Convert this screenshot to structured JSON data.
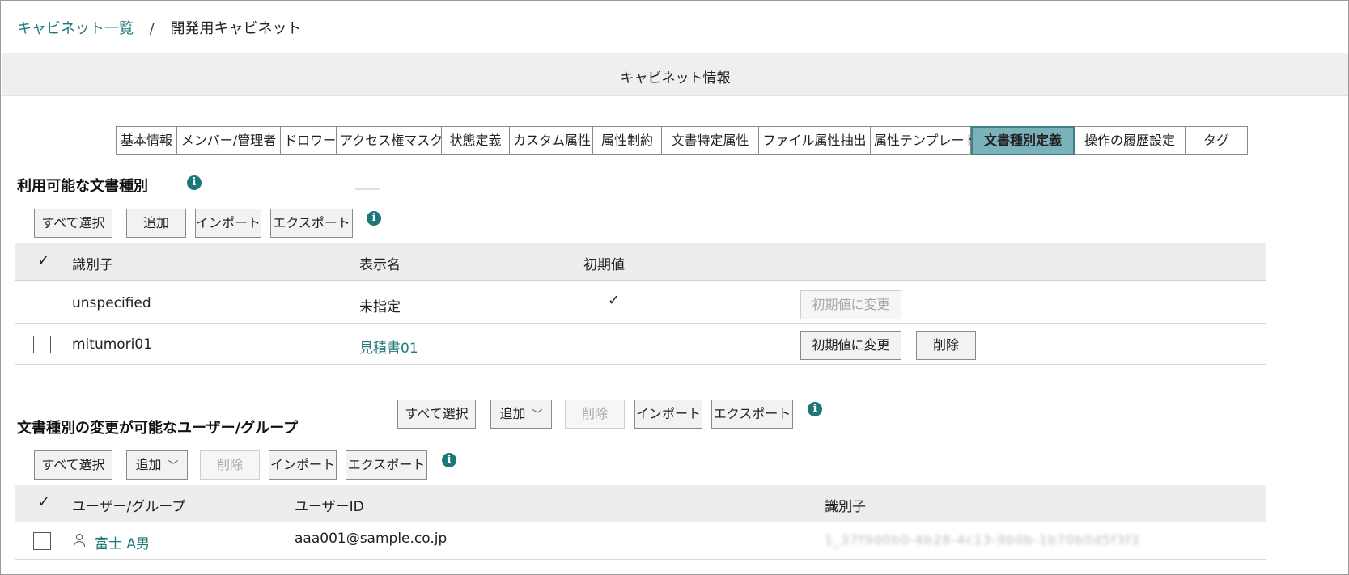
{
  "breadcrumb": {
    "link": "キャビネット一覧",
    "separator": "/",
    "current": "開発用キャビネット"
  },
  "section_title": "キャビネット情報",
  "tabs": [
    {
      "label": "基本情報"
    },
    {
      "label": "メンバー/管理者"
    },
    {
      "label": "ドロワー"
    },
    {
      "label": "アクセス権マスク"
    },
    {
      "label": "状態定義"
    },
    {
      "label": "カスタム属性"
    },
    {
      "label": "属性制約"
    },
    {
      "label": "文書特定属性"
    },
    {
      "label": "ファイル属性抽出"
    },
    {
      "label": "属性テンプレート"
    },
    {
      "label": "文書種別定義",
      "active": true
    },
    {
      "label": "操作の履歴設定"
    },
    {
      "label": "タグ"
    }
  ],
  "doc_types": {
    "heading": "利用可能な文書種別",
    "toolbar": {
      "select_all": "すべて選択",
      "add": "追加",
      "import": "インポート",
      "export": "エクスポート"
    },
    "columns": {
      "check": "✓",
      "identifier": "識別子",
      "display_name": "表示名",
      "default": "初期値"
    },
    "rows": [
      {
        "identifier": "unspecified",
        "display_name": "未指定",
        "default_mark": "✓",
        "set_default": "初期値に変更",
        "set_default_disabled": true
      },
      {
        "identifier": "mitumori01",
        "display_name": "見積書01",
        "set_default": "初期値に変更",
        "delete": "削除"
      }
    ]
  },
  "users": {
    "heading": "文書種別の変更が可能なユーザー/グループ",
    "upper_toolbar": {
      "select_all": "すべて選択",
      "add": "追加",
      "delete": "削除",
      "import": "インポート",
      "export": "エクスポート"
    },
    "lower_toolbar": {
      "select_all": "すべて選択",
      "add": "追加",
      "delete": "削除",
      "import": "インポート",
      "export": "エクスポート"
    },
    "columns": {
      "check": "✓",
      "user_group": "ユーザー/グループ",
      "user_id": "ユーザーID",
      "identifier": "識別子"
    },
    "rows": [
      {
        "name": "富士 A男",
        "user_id": "aaa001@sample.co.jp",
        "identifier_redacted": "1_37f9d0b0-4b28-4c13-9b0b-1b70b0d5f3f3"
      }
    ]
  }
}
